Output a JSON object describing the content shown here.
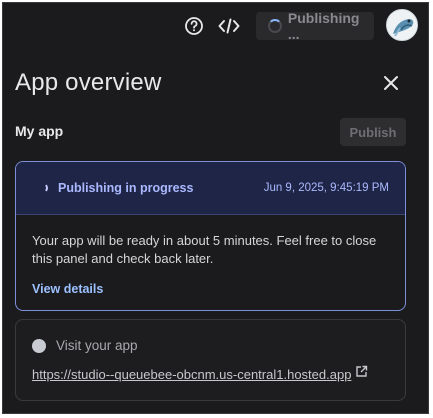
{
  "topbar": {
    "publishing_label": "Publishing ..."
  },
  "header": {
    "title": "App overview"
  },
  "app": {
    "name": "My app",
    "publish_label": "Publish"
  },
  "progress": {
    "status": "Publishing in progress",
    "timestamp": "Jun 9, 2025, 9:45:19 PM",
    "message": "Your app will be ready in about 5 minutes. Feel free to close this panel and check back later.",
    "details_link": "View details",
    "accent": "#aab9ff"
  },
  "visit": {
    "label": "Visit your app",
    "url": "https://studio--queuebee-obcnm.us-central1.hosted.app"
  }
}
